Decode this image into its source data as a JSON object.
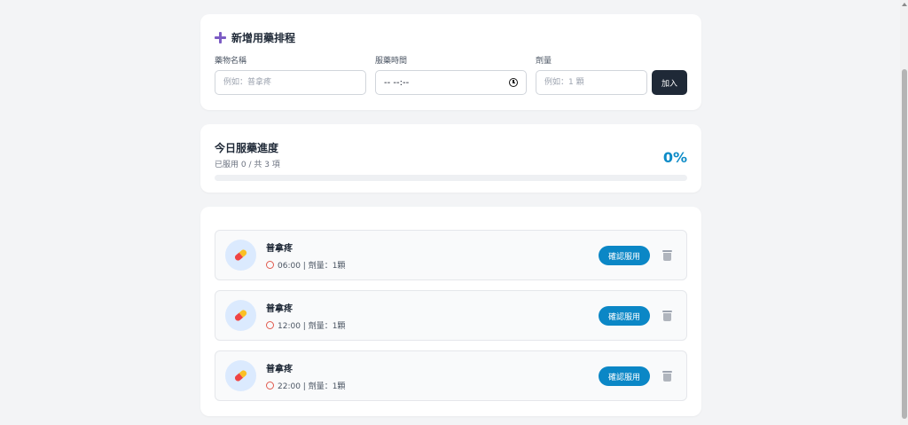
{
  "add_form": {
    "title": "新增用藥排程",
    "name_label": "藥物名稱",
    "name_placeholder": "例如：普拿疼",
    "time_label": "服藥時間",
    "time_value": "-- --:--",
    "dose_label": "劑量",
    "dose_placeholder": "例如：1 顆",
    "add_label": "加入"
  },
  "progress": {
    "title": "今日服藥進度",
    "summary": "已服用 0 / 共 3 項",
    "percent_text": "0%",
    "fraction": 0
  },
  "schedule": {
    "confirm_label": "確認服用",
    "items": [
      {
        "name": "普拿疼",
        "detail": "06:00 | 劑量：1顆"
      },
      {
        "name": "普拿疼",
        "detail": "12:00 | 劑量：1顆"
      },
      {
        "name": "普拿疼",
        "detail": "22:00 | 劑量：1顆"
      }
    ]
  },
  "colors": {
    "accent": "#0b87c6",
    "dark_button": "#1f2937",
    "plus_icon": "#7c5cc4"
  }
}
